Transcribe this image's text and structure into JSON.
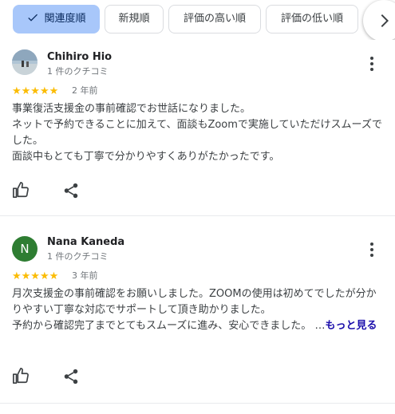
{
  "sort_chips": [
    {
      "label": "関連度順",
      "selected": true
    },
    {
      "label": "新規順",
      "selected": false
    },
    {
      "label": "評価の高い順",
      "selected": false
    },
    {
      "label": "評価の低い順",
      "selected": false
    }
  ],
  "reviews": [
    {
      "name": "Chihiro Hio",
      "review_count": "1 件のクチコミ",
      "rating": 5,
      "stars": "★★★★★",
      "date": "2 年前",
      "lines": [
        "事業復活支援金の事前確認でお世話になりました。",
        "ネットで予約できることに加えて、面談もZoomで実施していただけスムーズでした。",
        "面談中もとても丁寧で分かりやすくありがたかったです。"
      ]
    },
    {
      "name": "Nana Kaneda",
      "avatar_letter": "N",
      "review_count": "1 件のクチコミ",
      "rating": 5,
      "stars": "★★★★★",
      "date": "3 年前",
      "lines": [
        "月次支援金の事前確認をお願いしました。ZOOMの使用は初めてでしたが分かりやすい丁寧な対応でサポートして頂き助かりました。",
        "予約から確認完了までとてもスムーズに進み、安心できました。 …"
      ],
      "more_label": "もっと見る"
    }
  ],
  "colors": {
    "selected_chip": "#a8c7fa",
    "star": "#fbbc04",
    "avatar_n": "#2e7d32",
    "link": "#1a0dab"
  }
}
